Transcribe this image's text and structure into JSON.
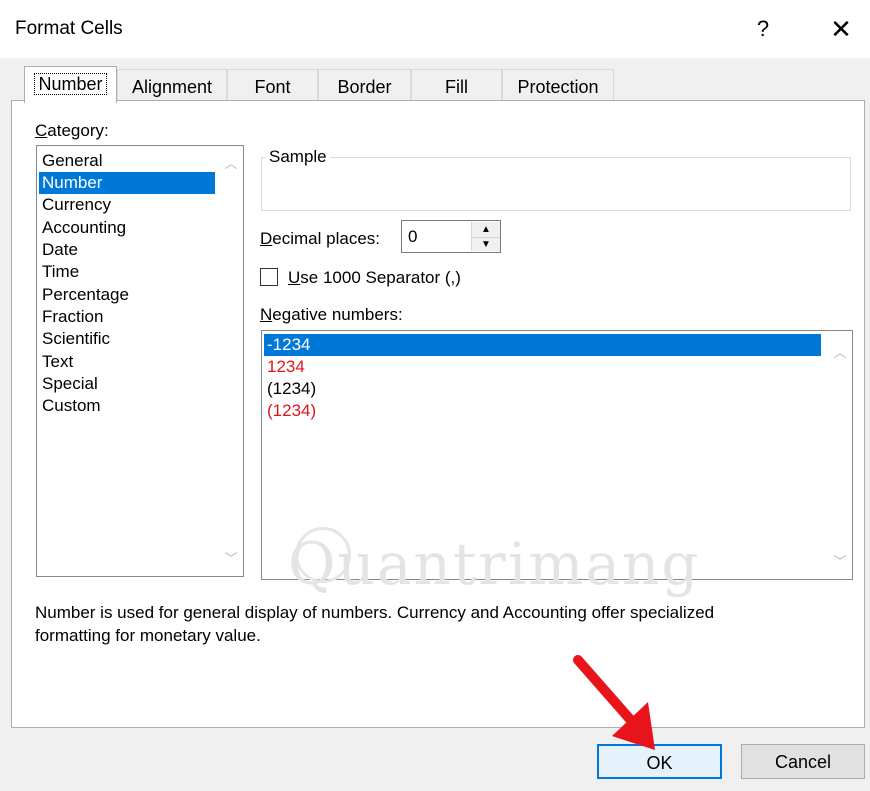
{
  "window": {
    "title": "Format Cells",
    "help_icon": "question-mark",
    "close_icon": "x"
  },
  "tabs": [
    {
      "label": "Number",
      "active": true
    },
    {
      "label": "Alignment",
      "active": false
    },
    {
      "label": "Font",
      "active": false
    },
    {
      "label": "Border",
      "active": false
    },
    {
      "label": "Fill",
      "active": false
    },
    {
      "label": "Protection",
      "active": false
    }
  ],
  "category": {
    "label": "Category:",
    "items": [
      "General",
      "Number",
      "Currency",
      "Accounting",
      "Date",
      "Time",
      "Percentage",
      "Fraction",
      "Scientific",
      "Text",
      "Special",
      "Custom"
    ],
    "selected": "Number"
  },
  "sample": {
    "label": "Sample",
    "value": ""
  },
  "decimal_places": {
    "label": "Decimal places:",
    "value": "0"
  },
  "separator": {
    "label": "Use 1000 Separator (,)",
    "checked": false
  },
  "negative_numbers": {
    "label": "Negative numbers:",
    "items": [
      {
        "text": "-1234",
        "color": "#000000",
        "selected": true
      },
      {
        "text": "1234",
        "color": "#e0161c",
        "selected": false
      },
      {
        "text": "(1234)",
        "color": "#000000",
        "selected": false
      },
      {
        "text": "(1234)",
        "color": "#e0161c",
        "selected": false
      }
    ]
  },
  "description": {
    "line1": "Number is used for general display of numbers.  Currency and Accounting offer specialized",
    "line2": "formatting for monetary value."
  },
  "watermark": "Quantrimang",
  "buttons": {
    "ok": "OK",
    "cancel": "Cancel"
  },
  "colors": {
    "selection": "#0078d7",
    "negative_red": "#e0161c",
    "annotation_arrow": "#e8141b"
  }
}
